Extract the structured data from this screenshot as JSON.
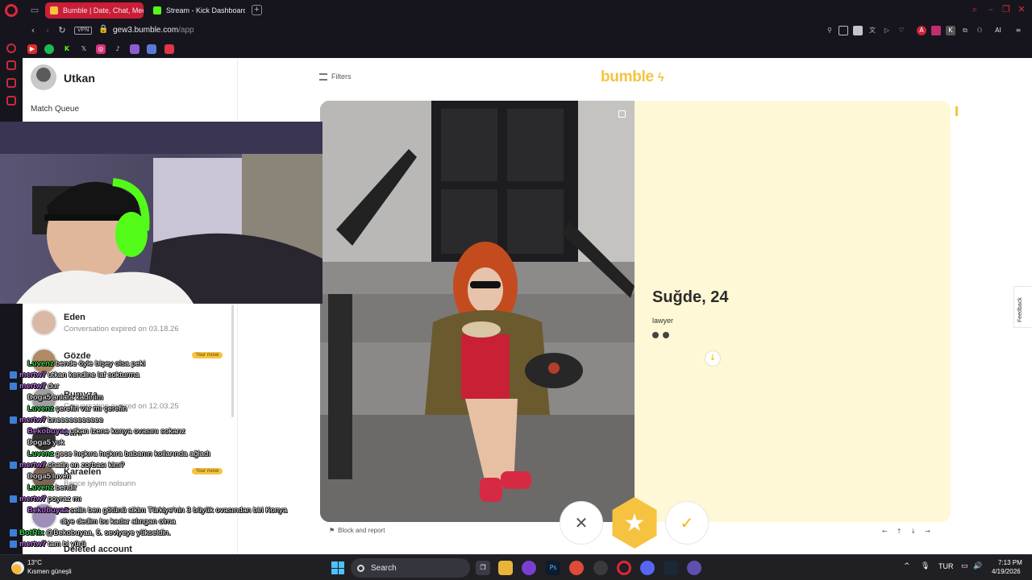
{
  "browser": {
    "tabs": [
      {
        "label": "Bumble | Date, Chat, Meet",
        "active": true
      },
      {
        "label": "Stream - Kick Dashboard",
        "active": false
      }
    ],
    "vpn_label": "VPN",
    "url_host": "gew3.bumble.com",
    "url_path": "/app",
    "ai_label": "AI",
    "bookmarks": [
      "youtube-icon",
      "spotify-icon",
      "kick-icon",
      "x-icon",
      "instagram-icon",
      "tiktok-icon",
      "twitch-icon",
      "messenger-icon",
      "discord-icon"
    ]
  },
  "left_pane": {
    "user_name": "Utkan",
    "queue_label": "Match Queue",
    "conversations": [
      {
        "name": "Eden",
        "sub": "Conversation expired on 03.18.26",
        "your_move": ""
      },
      {
        "name": "Gözde",
        "sub": "",
        "your_move": "Your move"
      },
      {
        "name": "Rumyza",
        "sub": "Conversation expired on 12.03.25",
        "your_move": ""
      },
      {
        "name": "Sahr",
        "sub": "",
        "your_move": ""
      },
      {
        "name": "Karaelen",
        "sub": "Bence iyiyim nolsunn",
        "your_move": "Your move"
      },
      {
        "name": "Pen",
        "sub": "",
        "your_move": ""
      },
      {
        "name": "Deleted account",
        "sub": "",
        "your_move": ""
      }
    ]
  },
  "main": {
    "filters_label": "Filters",
    "logo": "bumble",
    "profile": {
      "name": "Suğde, 24",
      "job": "lawyer"
    },
    "block_report": "Block and report",
    "pass_symbol": "✕",
    "superswipe_symbol": "★",
    "like_symbol": "✓",
    "feedback_label": "Feedback",
    "kbd_hints": [
      "←",
      "↑",
      "↓",
      "→"
    ]
  },
  "chat": [
    {
      "nick": "Luvenz",
      "color": "#39d353",
      "msg": "bende öyle bişey olsa peki",
      "badge": false
    },
    {
      "nick": "mertw7",
      "color": "#b06dd6",
      "msg": "utkan kendine laf sokturma",
      "badge": true
    },
    {
      "nick": "mertw7",
      "color": "#b06dd6",
      "msg": "dur",
      "badge": true
    },
    {
      "nick": "Doga5",
      "color": "#d0d0d0",
      "msg": "anlara kadınım",
      "badge": false
    },
    {
      "nick": "Luvenz",
      "color": "#39d353",
      "msg": "çerefin var mı çerefin",
      "badge": false
    },
    {
      "nick": "mertw7",
      "color": "#b06dd6",
      "msg": "bneeeeeeeeeee",
      "badge": true
    },
    {
      "nick": "Bekobuyaa",
      "color": "#b06dd6",
      "msg": "utkan izene konya ovasını sokarız",
      "badge": false
    },
    {
      "nick": "Doga5",
      "color": "#d0d0d0",
      "msg": "yok",
      "badge": false
    },
    {
      "nick": "Luvenz",
      "color": "#39d353",
      "msg": "gece hıçkıra hıçkıra babanın kollarında ağladı",
      "badge": false
    },
    {
      "nick": "mertw7",
      "color": "#b06dd6",
      "msg": "chatin en zorbası kim?",
      "badge": true
    },
    {
      "nick": "Doga5",
      "color": "#d0d0d0",
      "msg": "luven",
      "badge": false
    },
    {
      "nick": "Luvenz",
      "color": "#39d353",
      "msg": "bendir",
      "badge": false
    },
    {
      "nick": "mertw7",
      "color": "#b06dd6",
      "msg": "poyraz mı",
      "badge": true
    },
    {
      "nick": "Bekobuyaa",
      "color": "#b06dd6",
      "msg": "selin ben götünü sikim Türkiye'nin 3 büyük ovasından biri Konya",
      "badge": false
    },
    {
      "nick": "",
      "color": "#ffffff",
      "msg": "diye dedim bu kadar alıngan olma",
      "badge": false
    },
    {
      "nick": "BotRix",
      "color": "#39d353",
      "msg": "@Bekobuyaa, 5. seviyeye yükseldin.",
      "badge": true
    },
    {
      "nick": "mertw7",
      "color": "#b06dd6",
      "msg": "tam bi yürü",
      "badge": true
    }
  ],
  "taskbar": {
    "temperature": "13°C",
    "weather": "Kısmen güneşli",
    "search_label": "Search",
    "language": "TUR",
    "time": "7:13 PM",
    "date": "4/19/2026"
  },
  "colors": {
    "bumble_yellow": "#f6c340",
    "card_bg": "#fff8d6",
    "opera_red": "#cc1d37"
  }
}
